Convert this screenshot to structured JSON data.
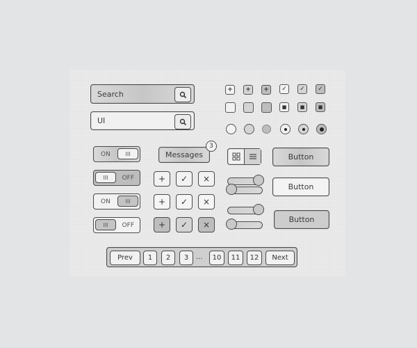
{
  "search_fields": [
    {
      "value": "Search",
      "icon": "magnifier-icon"
    },
    {
      "value": "UI",
      "icon": "magnifier-icon"
    }
  ],
  "checkbox_grid": {
    "row1": [
      {
        "glyph": "+",
        "state": "normal"
      },
      {
        "glyph": "+",
        "state": "hover"
      },
      {
        "glyph": "+",
        "state": "pressed"
      },
      {
        "glyph": "✓",
        "state": "normal"
      },
      {
        "glyph": "✓",
        "state": "hover"
      },
      {
        "glyph": "✓",
        "state": "pressed"
      }
    ],
    "row2": [
      {
        "glyph": "",
        "state": "normal"
      },
      {
        "glyph": "",
        "state": "hover"
      },
      {
        "glyph": "",
        "state": "pressed"
      },
      {
        "glyph": "■",
        "state": "normal"
      },
      {
        "glyph": "■",
        "state": "hover"
      },
      {
        "glyph": "■",
        "state": "pressed"
      }
    ],
    "radios": [
      {
        "checked": false,
        "state": "normal"
      },
      {
        "checked": false,
        "state": "hover"
      },
      {
        "checked": false,
        "state": "pressed"
      },
      {
        "checked": true,
        "state": "normal"
      },
      {
        "checked": true,
        "state": "hover"
      },
      {
        "checked": true,
        "state": "pressed"
      }
    ]
  },
  "toggles": [
    {
      "on_label": "ON",
      "off_label": "",
      "knob": "III",
      "state": "on"
    },
    {
      "on_label": "",
      "off_label": "OFF",
      "knob": "III",
      "state": "off"
    },
    {
      "on_label": "ON",
      "off_label": "",
      "knob": "III",
      "state": "on"
    },
    {
      "on_label": "",
      "off_label": "OFF",
      "knob": "III",
      "state": "off"
    }
  ],
  "messages": {
    "label": "Messages",
    "badge": "3"
  },
  "icon_buttons": {
    "rows": [
      [
        "+",
        "✓",
        "×"
      ],
      [
        "+",
        "✓",
        "×"
      ],
      [
        "+",
        "✓",
        "×"
      ]
    ]
  },
  "view_switch": {
    "grid_icon": "grid-view-icon",
    "list_icon": "list-view-icon",
    "selected": "list"
  },
  "sliders": [
    {
      "value": 1.0
    },
    {
      "value": 0.0
    },
    {
      "value": 1.0
    },
    {
      "value": 0.0
    }
  ],
  "buttons": [
    {
      "label": "Button",
      "state": "normal"
    },
    {
      "label": "Button",
      "state": "hover"
    },
    {
      "label": "Button",
      "state": "pressed"
    }
  ],
  "pagination": {
    "prev": "Prev",
    "pages": [
      "1",
      "2",
      "3",
      "10",
      "11",
      "12"
    ],
    "ellipsis": "...",
    "next": "Next"
  }
}
